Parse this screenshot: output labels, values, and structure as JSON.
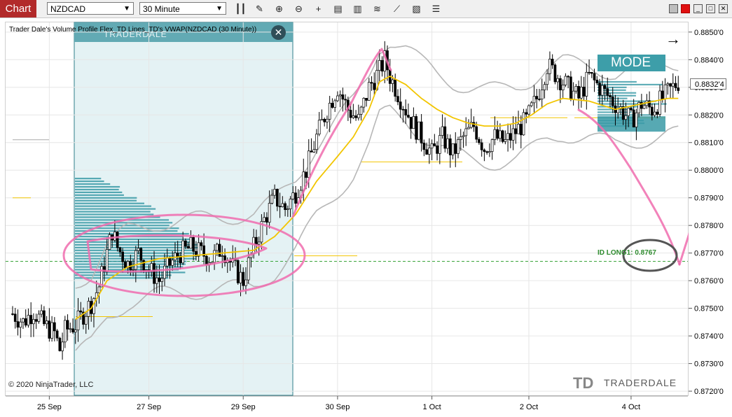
{
  "toolbar": {
    "tab_label": "Chart",
    "instrument": "NZDCAD",
    "interval": "30 Minute",
    "icons": [
      "bars-icon",
      "draw-pencil-icon",
      "zoom-in-icon",
      "zoom-out-icon",
      "crosshair-icon",
      "properties-icon",
      "data-box-icon",
      "indicators-icon",
      "strategies-icon",
      "drawing-objects-icon",
      "more-menu-icon"
    ]
  },
  "chart": {
    "indicator_label": "Trader Dale's Volume Profile Flex_TD Lines_TD's VWAP(NZDCAD (30 Minute))",
    "watermark_text": "TRADERDALE",
    "copyright": "© 2020 NinjaTrader, LLC",
    "logo_text": "TRADERDALE",
    "logo_mark": "TD",
    "mode_label": "MODE",
    "long_label": "ID LONG1: 0.8767",
    "last_price": "0.8832'4",
    "colors": {
      "candle": "#000000",
      "vwap": "#f2c500",
      "bands": "#b7b7b7",
      "profile": "#3a9aa6",
      "selection": "#e4f2f4",
      "annotation": "#f06cae",
      "long_line": "#3aa53a"
    }
  },
  "chart_data": {
    "type": "candlestick",
    "instrument": "NZDCAD",
    "interval": "30 Minute",
    "x_tick_labels": [
      "25 Sep",
      "27 Sep",
      "29 Sep",
      "30 Sep",
      "1 Oct",
      "2 Oct",
      "4 Oct"
    ],
    "y_tick_labels": [
      "0.8850'0",
      "0.8840'0",
      "0.8830'0",
      "0.8820'0",
      "0.8810'0",
      "0.8800'0",
      "0.8790'0",
      "0.8780'0",
      "0.8770'0",
      "0.8760'0",
      "0.8750'0",
      "0.8740'0",
      "0.8730'0",
      "0.8720'0"
    ],
    "ylim": [
      0.87185,
      0.88535
    ],
    "y_ticks": [
      0.885,
      0.884,
      0.883,
      0.882,
      0.881,
      0.88,
      0.879,
      0.878,
      0.877,
      0.876,
      0.875,
      0.874,
      0.873,
      0.872
    ],
    "long_level": 0.8767,
    "last_price": 0.88324,
    "price_path": [
      [
        0,
        0.8748
      ],
      [
        4,
        0.8745
      ],
      [
        8,
        0.8749
      ],
      [
        12,
        0.8744
      ],
      [
        16,
        0.8741
      ],
      [
        18,
        0.8735
      ],
      [
        20,
        0.8742
      ],
      [
        24,
        0.8744
      ],
      [
        27,
        0.8748
      ],
      [
        30,
        0.8752
      ],
      [
        33,
        0.8758
      ],
      [
        36,
        0.877
      ],
      [
        38,
        0.8778
      ],
      [
        40,
        0.8772
      ],
      [
        44,
        0.8766
      ],
      [
        48,
        0.877
      ],
      [
        52,
        0.8764
      ],
      [
        56,
        0.876
      ],
      [
        60,
        0.8766
      ],
      [
        64,
        0.877
      ],
      [
        68,
        0.8772
      ],
      [
        72,
        0.877
      ],
      [
        76,
        0.8768
      ],
      [
        80,
        0.8772
      ],
      [
        84,
        0.8765
      ],
      [
        88,
        0.876
      ],
      [
        92,
        0.8772
      ],
      [
        96,
        0.8782
      ],
      [
        100,
        0.879
      ],
      [
        104,
        0.8786
      ],
      [
        108,
        0.8792
      ],
      [
        112,
        0.88
      ],
      [
        116,
        0.8812
      ],
      [
        120,
        0.8822
      ],
      [
        124,
        0.883
      ],
      [
        128,
        0.8822
      ],
      [
        132,
        0.8818
      ],
      [
        136,
        0.883
      ],
      [
        140,
        0.8836
      ],
      [
        142,
        0.884
      ],
      [
        144,
        0.8834
      ],
      [
        148,
        0.8826
      ],
      [
        152,
        0.8818
      ],
      [
        156,
        0.8812
      ],
      [
        160,
        0.8806
      ],
      [
        164,
        0.8812
      ],
      [
        168,
        0.8806
      ],
      [
        172,
        0.8812
      ],
      [
        176,
        0.8816
      ],
      [
        180,
        0.8808
      ],
      [
        184,
        0.8812
      ],
      [
        188,
        0.881
      ],
      [
        192,
        0.8814
      ],
      [
        196,
        0.8818
      ],
      [
        200,
        0.8826
      ],
      [
        204,
        0.8838
      ],
      [
        208,
        0.8834
      ],
      [
        212,
        0.883
      ],
      [
        216,
        0.8826
      ],
      [
        220,
        0.8834
      ],
      [
        224,
        0.883
      ],
      [
        228,
        0.8826
      ],
      [
        232,
        0.8822
      ],
      [
        236,
        0.8818
      ],
      [
        240,
        0.8824
      ],
      [
        244,
        0.8822
      ],
      [
        248,
        0.8826
      ],
      [
        252,
        0.883
      ],
      [
        254,
        0.8832
      ]
    ],
    "vwap_path": [
      [
        24,
        0.8746
      ],
      [
        30,
        0.875
      ],
      [
        36,
        0.876
      ],
      [
        44,
        0.8765
      ],
      [
        56,
        0.8768
      ],
      [
        68,
        0.8769
      ],
      [
        80,
        0.877
      ],
      [
        92,
        0.8771
      ],
      [
        100,
        0.8776
      ],
      [
        108,
        0.8784
      ],
      [
        116,
        0.8796
      ],
      [
        124,
        0.8805
      ],
      [
        130,
        0.8812
      ],
      [
        136,
        0.8822
      ],
      [
        140,
        0.8832
      ],
      [
        144,
        0.8834
      ],
      [
        150,
        0.8831
      ],
      [
        156,
        0.8826
      ],
      [
        162,
        0.8822
      ],
      [
        168,
        0.8819
      ],
      [
        174,
        0.8817
      ],
      [
        180,
        0.8816
      ],
      [
        186,
        0.8816
      ],
      [
        192,
        0.8817
      ],
      [
        198,
        0.882
      ],
      [
        204,
        0.8824
      ],
      [
        210,
        0.8826
      ],
      [
        220,
        0.8825
      ],
      [
        230,
        0.8822
      ],
      [
        240,
        0.8824
      ],
      [
        250,
        0.8826
      ]
    ]
  }
}
